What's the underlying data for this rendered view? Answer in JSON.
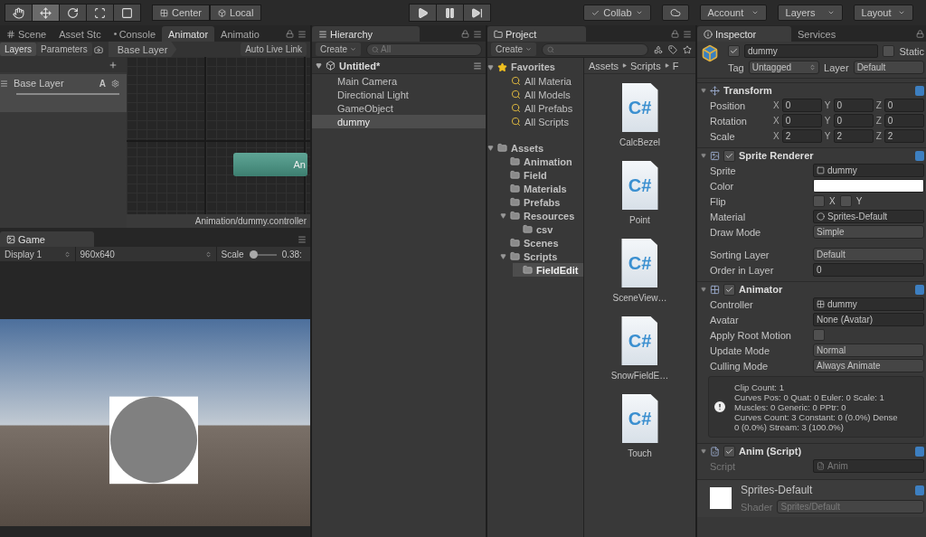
{
  "toolbar": {
    "tools": [
      {
        "kind": "hand",
        "selected": false
      },
      {
        "kind": "move",
        "selected": true
      },
      {
        "kind": "rotate",
        "selected": false
      },
      {
        "kind": "scale",
        "selected": false
      },
      {
        "kind": "rect",
        "selected": false
      }
    ],
    "pivot": [
      {
        "kind": "center",
        "label": "Center"
      },
      {
        "kind": "local",
        "label": "Local"
      }
    ],
    "playback": [
      {
        "kind": "play",
        "selected": false
      },
      {
        "kind": "pause",
        "selected": false
      },
      {
        "kind": "step",
        "selected": false
      }
    ],
    "collab": "Collab",
    "account": "Account",
    "layers": "Layers",
    "layout": "Layout"
  },
  "animator_panel": {
    "tabs": [
      {
        "label": "Scene",
        "kind": "scene",
        "selected": false
      },
      {
        "label": "Asset Stc",
        "kind": "plain",
        "selected": false
      },
      {
        "label": "Console",
        "kind": "console",
        "selected": false
      },
      {
        "label": "Animator",
        "kind": "plain",
        "selected": true
      },
      {
        "label": "Animatio",
        "kind": "plain",
        "selected": false
      }
    ],
    "subtabs": [
      {
        "label": "Layers",
        "selected": true
      },
      {
        "label": "Parameters",
        "selected": false
      }
    ],
    "breadcrumb": "Base Layer",
    "live_link": "Auto Live Link",
    "layers": [
      {
        "name": "Base Layer",
        "badge": "A"
      }
    ],
    "state_node": "An",
    "controller_path": "Animation/dummy.controller"
  },
  "game_panel": {
    "tab": "Game",
    "display": "Display 1",
    "resolution": "960x640",
    "scale_label": "Scale",
    "scale": {
      "level": 0.1
    },
    "scale_reading": "0.38:"
  },
  "hierarchy": {
    "title": "Hierarchy",
    "create": "Create",
    "search": {
      "placeholder": "All"
    },
    "scene": "Untitled*",
    "items": [
      {
        "name": "Main Camera",
        "selected": false
      },
      {
        "name": "Directional Light",
        "selected": false
      },
      {
        "name": "GameObject",
        "selected": false
      },
      {
        "name": "dummy",
        "selected": true
      }
    ]
  },
  "project": {
    "title": "Project",
    "create": "Create",
    "favorites": {
      "label": "Favorites",
      "items": [
        "All Materia",
        "All Models",
        "All Prefabs",
        "All Scripts"
      ]
    },
    "assets": {
      "name": "Assets",
      "expanded": true,
      "selected": false,
      "children": [
        {
          "name": "Animation",
          "selected": false
        },
        {
          "name": "Field",
          "selected": false
        },
        {
          "name": "Materials",
          "selected": false
        },
        {
          "name": "Prefabs",
          "selected": false
        },
        {
          "name": "Resources",
          "expanded": true,
          "selected": false,
          "children": [
            {
              "name": "csv",
              "selected": false
            }
          ]
        },
        {
          "name": "Scenes",
          "selected": false
        },
        {
          "name": "Scripts",
          "expanded": true,
          "selected": false,
          "children": [
            {
              "name": "FieldEdit",
              "selected": true
            }
          ]
        }
      ]
    },
    "path": [
      "Assets",
      "Scripts",
      "F"
    ],
    "files": [
      {
        "name": "CalcBezel",
        "badge": "C#"
      },
      {
        "name": "Point",
        "badge": "C#"
      },
      {
        "name": "SceneView…",
        "badge": "C#"
      },
      {
        "name": "SnowFieldE…",
        "badge": "C#"
      },
      {
        "name": "Touch",
        "badge": "C#"
      }
    ]
  },
  "inspector": {
    "tabs": [
      {
        "label": "Inspector",
        "selected": true
      },
      {
        "label": "Services",
        "selected": false
      }
    ],
    "object": {
      "active": true,
      "name": "dummy",
      "static_label": "Static",
      "static": false,
      "tag_label": "Tag",
      "tag": "Untagged",
      "layer_label": "Layer",
      "layer": "Default"
    },
    "components": [
      {
        "kind": "transform",
        "title": "Transform",
        "rows": [
          {
            "kind": "vector",
            "label": "Position",
            "axes": [
              {
                "axis": "X",
                "value": "0"
              },
              {
                "axis": "Y",
                "value": "0"
              },
              {
                "axis": "Z",
                "value": "0"
              }
            ]
          },
          {
            "kind": "vector",
            "label": "Rotation",
            "axes": [
              {
                "axis": "X",
                "value": "0"
              },
              {
                "axis": "Y",
                "value": "0"
              },
              {
                "axis": "Z",
                "value": "0"
              }
            ]
          },
          {
            "kind": "vector",
            "label": "Scale",
            "axes": [
              {
                "axis": "X",
                "value": "2"
              },
              {
                "axis": "Y",
                "value": "2"
              },
              {
                "axis": "Z",
                "value": "2"
              }
            ]
          }
        ]
      },
      {
        "kind": "sprite",
        "title": "Sprite Renderer",
        "enabled": true,
        "rows": [
          {
            "kind": "object",
            "label": "Sprite",
            "value": "dummy"
          },
          {
            "kind": "color",
            "label": "Color",
            "color": "#ffffff"
          },
          {
            "kind": "flip",
            "label": "Flip",
            "options": [
              {
                "label": "X",
                "checked": false
              },
              {
                "label": "Y",
                "checked": false
              }
            ]
          },
          {
            "kind": "object",
            "label": "Material",
            "value": "Sprites-Default"
          },
          {
            "kind": "dropdown",
            "label": "Draw Mode",
            "value": "Simple"
          },
          {
            "kind": "dropdown",
            "label": "Sorting Layer",
            "value": "Default",
            "spaced": true
          },
          {
            "kind": "text",
            "label": "Order in Layer",
            "value": "0"
          }
        ]
      },
      {
        "kind": "animator",
        "title": "Animator",
        "enabled": true,
        "rows": [
          {
            "kind": "object",
            "label": "Controller",
            "value": "dummy"
          },
          {
            "kind": "text",
            "label": "Avatar",
            "value": "None (Avatar)"
          },
          {
            "kind": "checkbox",
            "label": "Apply Root Motion",
            "checked": false
          },
          {
            "kind": "dropdown",
            "label": "Update Mode",
            "value": "Normal"
          },
          {
            "kind": "dropdown",
            "label": "Culling Mode",
            "value": "Always Animate"
          },
          {
            "kind": "info",
            "lines": [
              "Clip Count: 1",
              "Curves Pos: 0 Quat: 0 Euler: 0 Scale: 1",
              "Muscles: 0 Generic: 0 PPtr: 0",
              "Curves Count: 3 Constant: 0 (0.0%) Dense",
              "0 (0.0%) Stream: 3 (100.0%)"
            ]
          }
        ]
      },
      {
        "kind": "script",
        "title": "Anim (Script)",
        "enabled": true,
        "rows": [
          {
            "kind": "object",
            "label": "Script",
            "value": "Anim",
            "disabled": true
          }
        ]
      },
      {
        "kind": "material",
        "title": "Sprites-Default",
        "rows": [
          {
            "kind": "dropdown",
            "label": "Shader",
            "value": "Sprites/Default",
            "disabled": true
          }
        ]
      }
    ]
  }
}
